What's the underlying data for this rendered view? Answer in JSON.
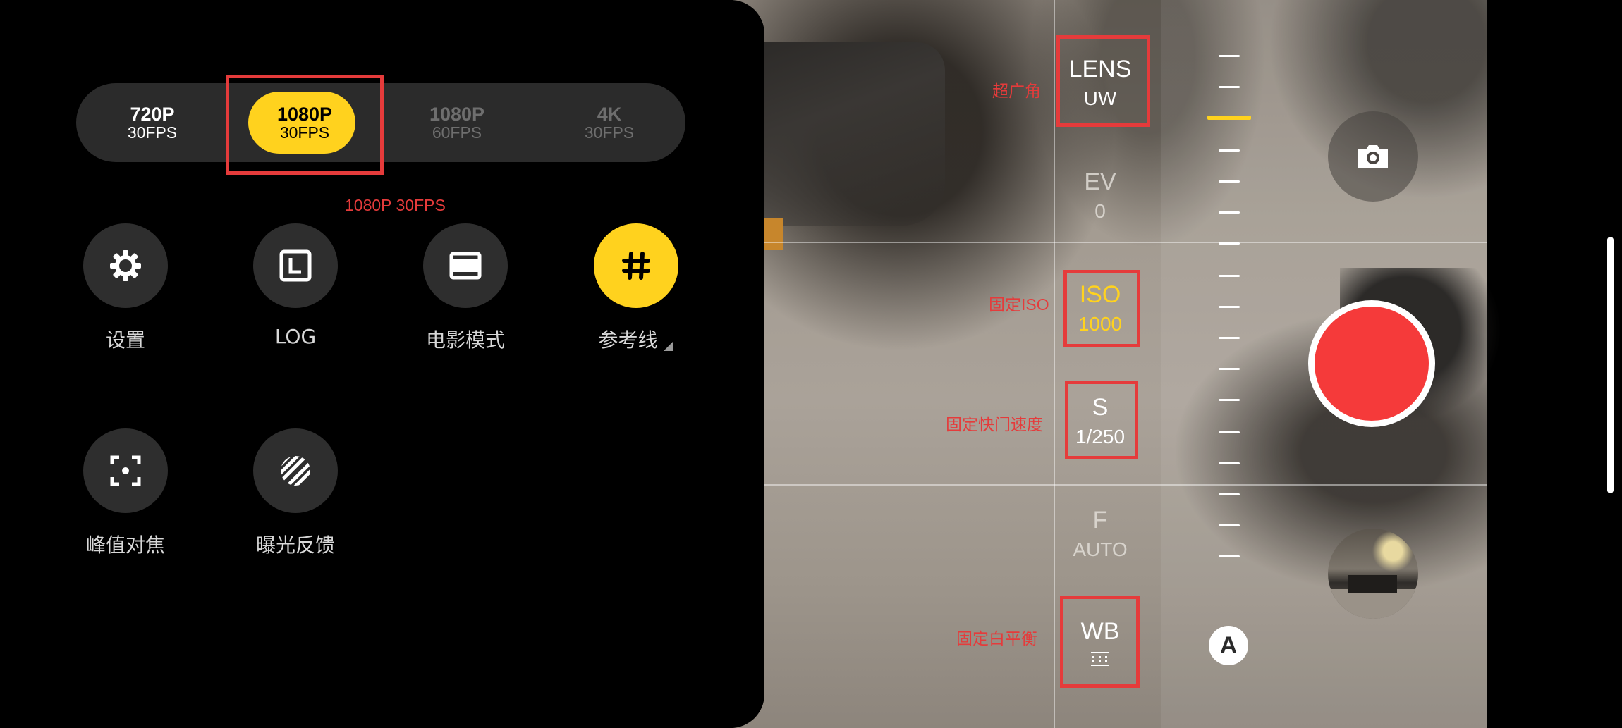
{
  "resolution": {
    "options": [
      {
        "res": "720P",
        "fps": "30FPS",
        "state": "normal"
      },
      {
        "res": "1080P",
        "fps": "30FPS",
        "state": "selected"
      },
      {
        "res": "1080P",
        "fps": "60FPS",
        "state": "disabled"
      },
      {
        "res": "4K",
        "fps": "30FPS",
        "state": "disabled"
      }
    ],
    "annotation": "1080P 30FPS"
  },
  "quick_settings": [
    {
      "label": "设置",
      "icon": "gear-icon"
    },
    {
      "label": "LOG",
      "icon": "log-icon"
    },
    {
      "label": "电影模式",
      "icon": "cinema-icon"
    },
    {
      "label": "参考线",
      "icon": "grid-icon",
      "active": true
    },
    {
      "label": "峰值对焦",
      "icon": "focus-peaking-icon"
    },
    {
      "label": "曝光反馈",
      "icon": "zebra-icon"
    }
  ],
  "params": {
    "lens": {
      "key": "LENS",
      "value": "UW",
      "annotation": "超广角"
    },
    "ev": {
      "key": "EV",
      "value": "0"
    },
    "iso": {
      "key": "ISO",
      "value": "1000",
      "annotation": "固定ISO"
    },
    "shutter": {
      "key": "S",
      "value": "1/250",
      "annotation": "固定快门速度"
    },
    "aperture": {
      "key": "F",
      "value": "AUTO"
    },
    "wb": {
      "key": "WB",
      "annotation": "固定白平衡"
    }
  },
  "auto_button": "A",
  "colors": {
    "accent": "#ffd21e",
    "record": "#f53a3a",
    "annotation": "#e53b3b",
    "panel": "#000000"
  }
}
